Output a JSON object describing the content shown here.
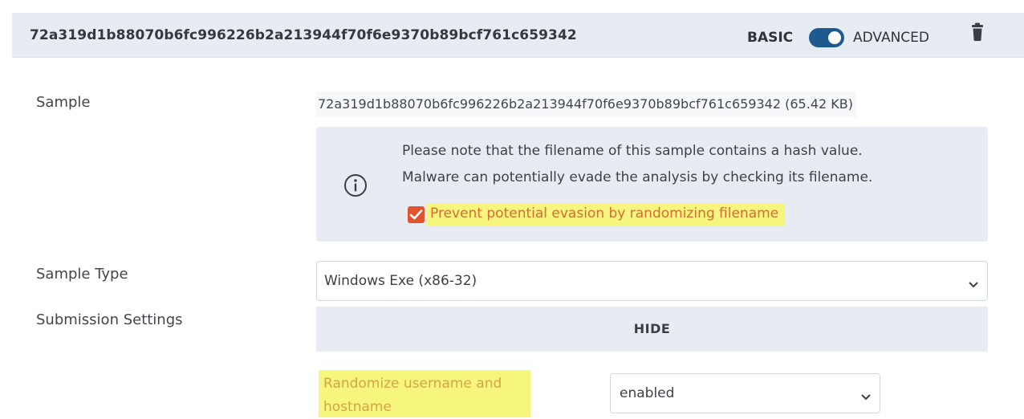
{
  "header": {
    "hash_title": "72a319d1b88070b6fc996226b2a213944f70f6e9370b89bcf761c659342",
    "mode_basic": "BASIC",
    "mode_advanced": "ADVANCED",
    "toggle_state": "advanced",
    "delete_icon": "trash-icon"
  },
  "form": {
    "sample_label": "Sample",
    "sample_value": "72a319d1b88070b6fc996226b2a213944f70f6e9370b89bcf761c659342 (65.42 KB)",
    "note": {
      "icon": "info-icon",
      "line1": "Please note that the filename of this sample contains a hash value.",
      "line2": "Malware can potentially evade the analysis by checking its filename.",
      "checkbox_label": "Prevent potential evasion by randomizing filename",
      "checkbox_checked": true
    },
    "sample_type_label": "Sample Type",
    "sample_type_value": "Windows Exe (x86-32)",
    "submission_settings_label": "Submission Settings",
    "hide_label": "HIDE",
    "randomize_label": "Randomize username and hostname",
    "randomize_value": "enabled"
  },
  "colors": {
    "accent": "#1f5a8f",
    "checkbox": "#e2542e",
    "highlight": "#f6f67e",
    "panel": "#e8ecf2"
  }
}
